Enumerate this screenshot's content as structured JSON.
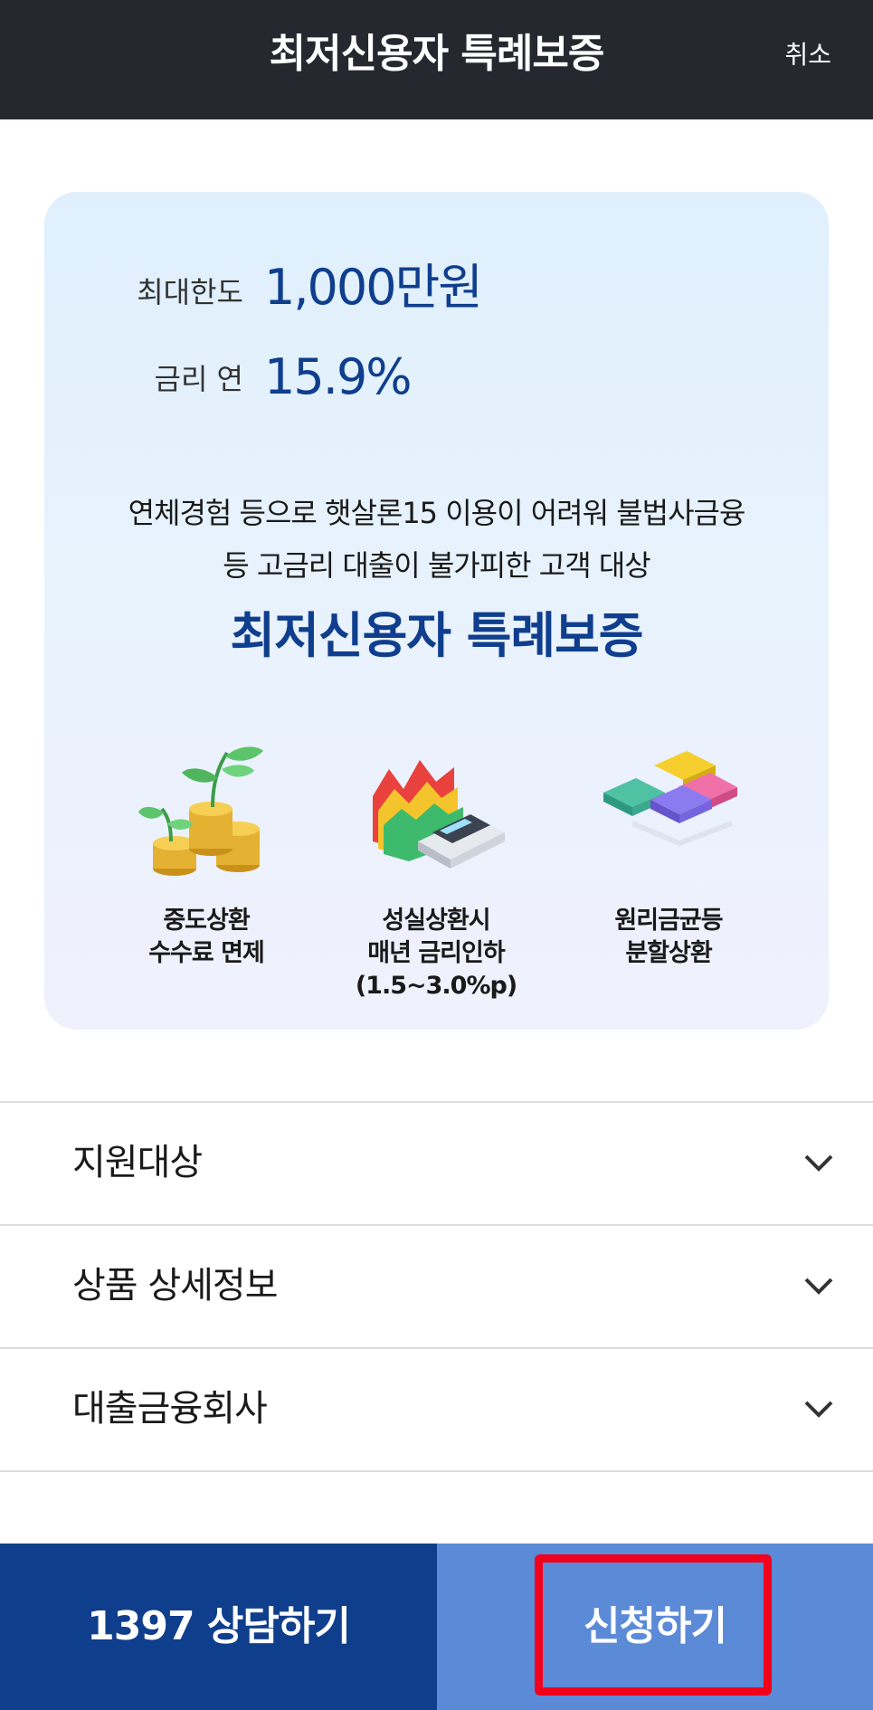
{
  "header": {
    "title": "최저신용자 특례보증",
    "cancel_label": "취소"
  },
  "summary": {
    "limit_label": "최대한도",
    "limit_value": "1,000만원",
    "rate_label": "금리 연",
    "rate_value": "15.9%",
    "desc_line1": "연체경험 등으로 햇살론15 이용이 어려워 불법사금융",
    "desc_line2": "등 고금리 대출이 불가피한 고객 대상",
    "headline": "최저신용자 특례보증"
  },
  "features": [
    {
      "icon": "plant-coins-icon",
      "line1": "중도상환",
      "line2": "수수료 면제",
      "line3": ""
    },
    {
      "icon": "chart-calculator-icon",
      "line1": "성실상환시",
      "line2": "매년 금리인하",
      "line3": "(1.5~3.0%p)"
    },
    {
      "icon": "puzzle-icon",
      "line1": "원리금균등",
      "line2": "분할상환",
      "line3": ""
    }
  ],
  "accordion": [
    {
      "label": "지원대상"
    },
    {
      "label": "상품 상세정보"
    },
    {
      "label": "대출금융회사"
    }
  ],
  "buttons": {
    "call_label": "1397 상담하기",
    "apply_label": "신청하기"
  },
  "colors": {
    "header_bg": "#262830",
    "brand_navy": "#103e8e",
    "call_bg": "#0f3e8d",
    "apply_bg": "#5b8ad7",
    "highlight_red": "#f2001b"
  }
}
